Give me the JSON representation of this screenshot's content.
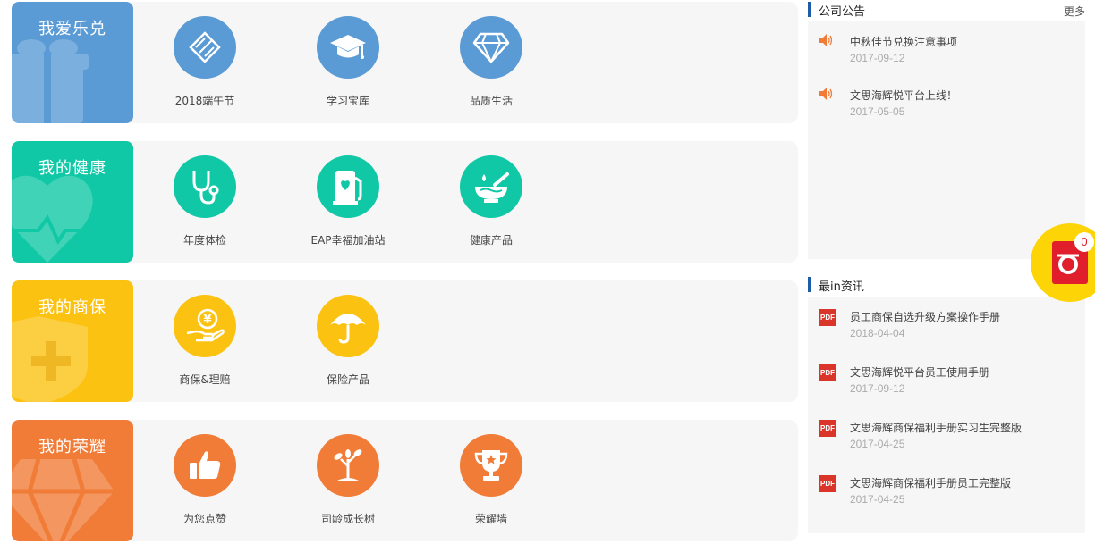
{
  "categories": [
    {
      "title": "我爱乐兑",
      "color": "#5b9bd5",
      "items": [
        {
          "label": "2018端午节",
          "icon": "zongzi-icon"
        },
        {
          "label": "学习宝库",
          "icon": "graduation-cap-icon"
        },
        {
          "label": "品质生活",
          "icon": "diamond-icon"
        }
      ]
    },
    {
      "title": "我的健康",
      "color": "#11c8a6",
      "items": [
        {
          "label": "年度体检",
          "icon": "stethoscope-icon"
        },
        {
          "label": "EAP幸福加油站",
          "icon": "fuel-pump-heart-icon"
        },
        {
          "label": "健康产品",
          "icon": "mortar-pestle-icon"
        }
      ]
    },
    {
      "title": "我的商保",
      "color": "#fcc212",
      "items": [
        {
          "label": "商保&理赔",
          "icon": "yen-coin-hand-icon"
        },
        {
          "label": "保险产品",
          "icon": "umbrella-icon"
        }
      ]
    },
    {
      "title": "我的荣耀",
      "color": "#f07c38",
      "items": [
        {
          "label": "为您点赞",
          "icon": "thumbs-up-icon"
        },
        {
          "label": "司龄成长树",
          "icon": "sprout-tree-icon"
        },
        {
          "label": "荣耀墙",
          "icon": "trophy-icon"
        }
      ]
    }
  ],
  "announcements": {
    "title": "公司公告",
    "more": "更多",
    "items": [
      {
        "title": "中秋佳节兑换注意事项",
        "date": "2017-09-12",
        "icon": "speaker-icon"
      },
      {
        "title": "文思海辉悦平台上线！",
        "date": "2017-05-05",
        "icon": "speaker-icon"
      }
    ]
  },
  "news": {
    "title": "最in资讯",
    "items": [
      {
        "title": "员工商保自选升级方案操作手册",
        "date": "2018-04-04",
        "icon": "pdf-icon"
      },
      {
        "title": "文思海辉悦平台员工使用手册",
        "date": "2017-09-12",
        "icon": "pdf-icon"
      },
      {
        "title": "文思海辉商保福利手册实习生完整版",
        "date": "2017-04-25",
        "icon": "pdf-icon"
      },
      {
        "title": "文思海辉商保福利手册员工完整版",
        "date": "2017-04-25",
        "icon": "pdf-icon"
      }
    ],
    "pdf_text": "PDF"
  },
  "cart": {
    "count": "0",
    "icon": "cart-icon"
  },
  "colors": {
    "speaker": "#f07c38",
    "pdf": "#d9352a",
    "title_bar": "#1e5ca8"
  }
}
